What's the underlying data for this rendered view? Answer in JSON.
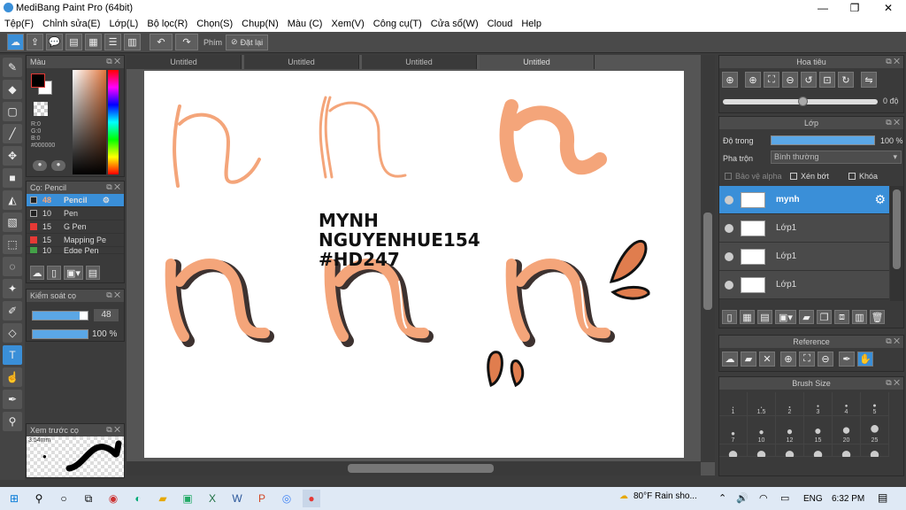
{
  "window": {
    "title": "MediBang Paint Pro (64bit)",
    "minimize": "—",
    "maximize": "❐",
    "close": "✕"
  },
  "menu": [
    "Tệp(F)",
    "Chỉnh sửa(E)",
    "Lớp(L)",
    "Bộ lọc(R)",
    "Chọn(S)",
    "Chụp(N)",
    "Màu (C)",
    "Xem(V)",
    "Công cụ(T)",
    "Cửa sổ(W)",
    "Cloud",
    "Help"
  ],
  "toolbar": {
    "key_label": "Phím",
    "reset_label": "Đặt lại"
  },
  "color_panel": {
    "title": "Màu",
    "r": "R:0",
    "g": "G:0",
    "b": "B:0",
    "hex": "#000000"
  },
  "brush_panel": {
    "title": "Cọ: Pencil",
    "items": [
      {
        "size": "48",
        "name": "Pencil",
        "color": "#222222"
      },
      {
        "size": "10",
        "name": "Pen",
        "color": "#222222"
      },
      {
        "size": "15",
        "name": "G Pen",
        "color": "#e53935"
      },
      {
        "size": "15",
        "name": "Mapping Pe",
        "color": "#e53935"
      },
      {
        "size": "10",
        "name": "Edge Pen",
        "color": "#43a047"
      }
    ]
  },
  "brush_control": {
    "title": "Kiểm soát cọ",
    "size": "48",
    "opacity": "100 %",
    "size_fill": 0.85,
    "opacity_fill": 1.0
  },
  "preview": {
    "title": "Xem trước cọ",
    "size": "3.54mm"
  },
  "tabs": [
    "Untitled",
    "Untitled",
    "Untitled",
    "Untitled"
  ],
  "canvas_text": {
    "line1": "MYNH",
    "line2": "NGUYENHUE154",
    "line3": "#HD247"
  },
  "navigator": {
    "title": "Hoa tiêu",
    "angle": "0 độ"
  },
  "layer_panel": {
    "title": "Lớp",
    "opacity_label": "Độ trong",
    "opacity_value": "100 %",
    "blend_label": "Pha trộn",
    "blend_value": "Bình thường",
    "protect_alpha": "Bảo vệ alpha",
    "clip": "Xén bớt",
    "lock": "Khóa",
    "layers": [
      {
        "name": "mynh",
        "selected": true
      },
      {
        "name": "Lớp1",
        "selected": false
      },
      {
        "name": "Lớp1",
        "selected": false
      },
      {
        "name": "Lớp1",
        "selected": false
      }
    ]
  },
  "reference": {
    "title": "Reference"
  },
  "brush_size": {
    "title": "Brush Size",
    "row1": [
      "1",
      "1.5",
      "2",
      "3",
      "4",
      "5"
    ],
    "row2": [
      "7",
      "10",
      "12",
      "15",
      "20",
      "25"
    ]
  },
  "taskbar": {
    "weather": "80°F  Rain sho...",
    "lang": "ENG",
    "time": "6:32 PM"
  },
  "colors": {
    "accent": "#3a8fd8",
    "stroke": "#f4a57a",
    "ink": "#111111"
  }
}
